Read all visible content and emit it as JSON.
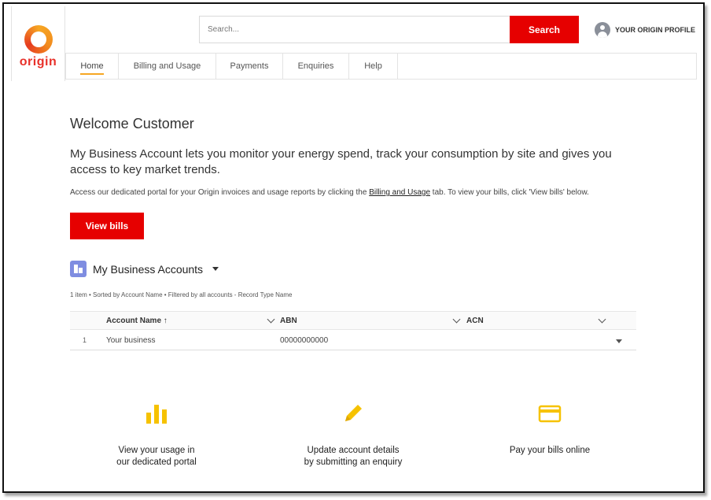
{
  "brand": {
    "logo_text": "origin",
    "accent": "#e60000",
    "gold": "#f6a623"
  },
  "header": {
    "search_placeholder": "Search...",
    "search_label": "Search",
    "profile_label": "YOUR ORIGIN PROFILE"
  },
  "nav": {
    "tabs": [
      {
        "label": "Home",
        "active": true
      },
      {
        "label": "Billing and Usage",
        "active": false
      },
      {
        "label": "Payments",
        "active": false
      },
      {
        "label": "Enquiries",
        "active": false
      },
      {
        "label": "Help",
        "active": false
      }
    ]
  },
  "main": {
    "welcome": "Welcome Customer",
    "intro": "My Business Account lets you monitor your energy spend, track your consumption by site and gives you access to key market trends.",
    "portal_note_before": "Access our dedicated portal for your Origin invoices and usage reports by clicking the ",
    "portal_note_link": "Billing and Usage",
    "portal_note_after": " tab. To view your bills, click 'View bills' below.",
    "view_bills_label": "View bills"
  },
  "accounts": {
    "title": "My Business Accounts",
    "meta": "1 item • Sorted by Account Name • Filtered by all accounts - Record Type Name",
    "columns": [
      "Account Name ↑",
      "ABN",
      "ACN"
    ],
    "rows": [
      {
        "index": "1",
        "account_name": "Your business",
        "abn": "00000000000",
        "acn": ""
      }
    ]
  },
  "features": [
    {
      "icon": "bar-chart-icon",
      "line1": "View your usage in",
      "line2": "our dedicated portal"
    },
    {
      "icon": "pencil-icon",
      "line1": "Update account details",
      "line2": "by submitting an enquiry"
    },
    {
      "icon": "credit-card-icon",
      "line1": "Pay your bills online",
      "line2": ""
    }
  ]
}
